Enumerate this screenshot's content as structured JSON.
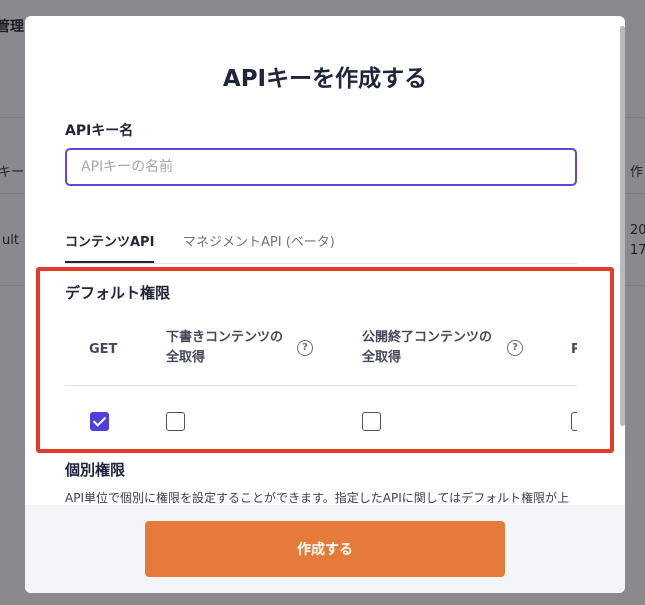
{
  "background": {
    "title_fragment": "管理",
    "col1_fragment": "キー",
    "col2_fragment": "作",
    "row_text": "ult",
    "row_value1": "20",
    "row_value2": "17"
  },
  "modal": {
    "title": "APIキーを作成する",
    "name_label": "APIキー名",
    "name_placeholder": "APIキーの名前",
    "name_value": "",
    "tabs": [
      {
        "label": "コンテンツAPI",
        "active": true
      },
      {
        "label": "マネジメントAPI (ベータ)",
        "active": false
      }
    ],
    "default_permissions": {
      "title": "デフォルト権限",
      "columns": [
        {
          "label": "GET",
          "has_help": false,
          "checked": true
        },
        {
          "label": "下書きコンテンツの全取得",
          "label_line1": "下書きコンテンツの",
          "label_line2": "全取得",
          "has_help": true,
          "checked": false
        },
        {
          "label": "公開終了コンテンツの全取得",
          "label_line1": "公開終了コンテンツの",
          "label_line2": "全取得",
          "has_help": true,
          "checked": false
        },
        {
          "label": "P",
          "has_help": false,
          "checked": false
        }
      ],
      "help_icon": "question-circle-icon",
      "help_glyph": "?"
    },
    "individual_permissions": {
      "title": "個別権限",
      "description": "API単位で個別に権限を設定することができます。指定したAPIに関してはデフォルト権限が上"
    },
    "create_button": "作成する"
  },
  "colors": {
    "accent": "#4f3fe0",
    "button": "#e57a3a",
    "highlight": "#e23a2c"
  }
}
